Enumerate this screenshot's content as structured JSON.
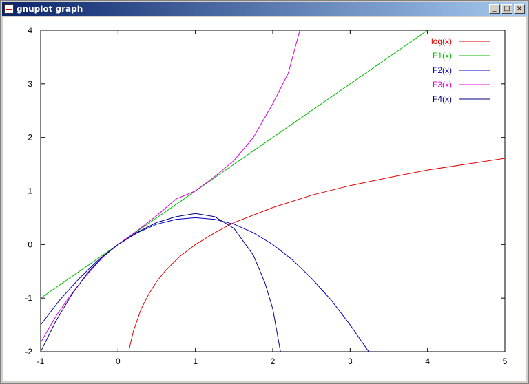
{
  "window": {
    "title": "gnuplot graph",
    "controls": {
      "minimize": "_",
      "maximize": "□",
      "close": "×"
    }
  },
  "chart_data": {
    "type": "line",
    "title": "",
    "xlabel": "",
    "ylabel": "",
    "xlim": [
      -1,
      5
    ],
    "ylim": [
      -2,
      4
    ],
    "xticks": [
      -1,
      0,
      1,
      2,
      3,
      4,
      5
    ],
    "yticks": [
      -2,
      -1,
      0,
      1,
      2,
      3,
      4
    ],
    "grid": false,
    "legend": "top-right",
    "series": [
      {
        "name": "log(x)",
        "color": "#e00000",
        "expr": "log",
        "x": [
          0.14,
          0.2,
          0.3,
          0.4,
          0.5,
          0.6,
          0.7,
          0.8,
          1.0,
          1.25,
          1.5,
          2.0,
          2.5,
          3.0,
          3.5,
          4.0,
          4.5,
          5.0
        ],
        "y": [
          -1.97,
          -1.61,
          -1.2,
          -0.92,
          -0.69,
          -0.51,
          -0.36,
          -0.22,
          0.0,
          0.22,
          0.41,
          0.69,
          0.92,
          1.1,
          1.25,
          1.39,
          1.5,
          1.61
        ]
      },
      {
        "name": "F1(x)",
        "color": "#00c000",
        "expr": "F1",
        "x": [
          -1.0,
          4.0
        ],
        "y": [
          -1.0,
          4.0
        ]
      },
      {
        "name": "F2(x)",
        "color": "#0000c0",
        "expr": "F2",
        "x": [
          -1.0,
          -0.75,
          -0.5,
          -0.25,
          0.0,
          0.25,
          0.5,
          0.75,
          1.0,
          1.25,
          1.5,
          1.75,
          2.0,
          2.25,
          2.5,
          2.75,
          3.0,
          3.24
        ],
        "y": [
          -1.5,
          -1.03,
          -0.63,
          -0.28,
          0.0,
          0.22,
          0.38,
          0.47,
          0.5,
          0.47,
          0.38,
          0.22,
          0.0,
          -0.28,
          -0.63,
          -1.03,
          -1.5,
          -2.0
        ]
      },
      {
        "name": "F3(x)",
        "color": "#e000e0",
        "expr": "F3",
        "x": [
          -1.0,
          -0.8,
          -0.6,
          -0.4,
          -0.2,
          0.0,
          0.25,
          0.5,
          0.75,
          1.0,
          1.25,
          1.5,
          1.75,
          2.0,
          2.2,
          2.35
        ],
        "y": [
          -1.83,
          -1.33,
          -0.92,
          -0.56,
          -0.24,
          0.0,
          0.26,
          0.54,
          0.85,
          1.0,
          1.27,
          1.57,
          2.0,
          2.63,
          3.2,
          4.0
        ]
      },
      {
        "name": "F4(x)",
        "color": "#000080",
        "expr": "F4",
        "x": [
          -1.0,
          -0.8,
          -0.6,
          -0.4,
          -0.2,
          0.0,
          0.25,
          0.5,
          0.75,
          1.0,
          1.25,
          1.5,
          1.75,
          1.9,
          2.0,
          2.1
        ],
        "y": [
          -2.0,
          -1.42,
          -0.94,
          -0.54,
          -0.23,
          0.0,
          0.23,
          0.41,
          0.52,
          0.58,
          0.52,
          0.3,
          -0.2,
          -0.72,
          -1.2,
          -2.0
        ]
      }
    ]
  }
}
